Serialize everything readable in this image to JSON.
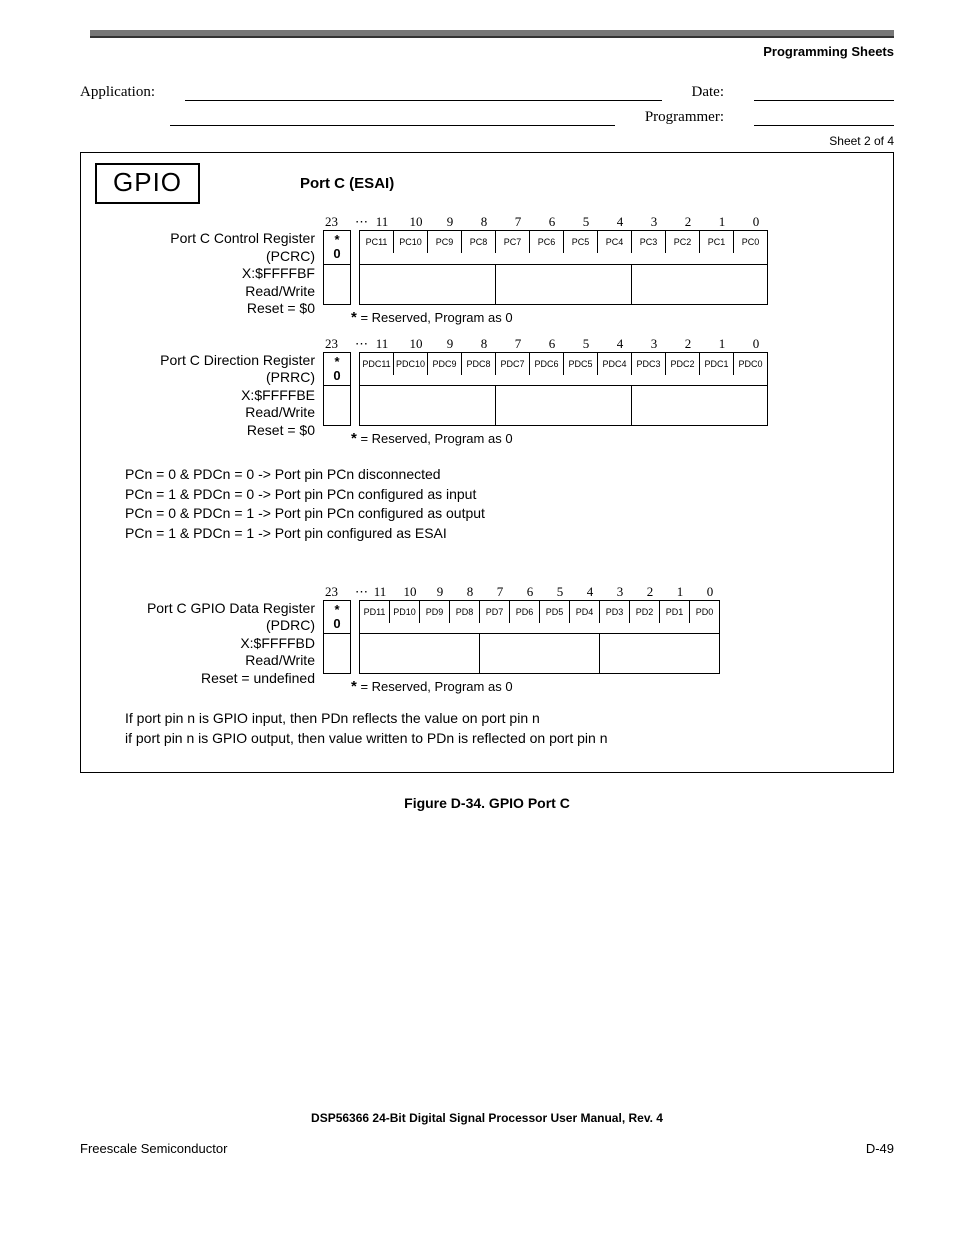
{
  "header": {
    "section": "Programming Sheets"
  },
  "form": {
    "application_label": "Application:",
    "date_label": "Date:",
    "programmer_label": "Programmer:",
    "sheet": "Sheet 2 of 4"
  },
  "diagram": {
    "gpio": "GPIO",
    "port_title": "Port C (ESAI)",
    "reserved_note_star": "*",
    "reserved_note": " = Reserved, Program as 0",
    "reg1": {
      "name": "Port C Control Register",
      "short": "(PCRC)",
      "addr": "X:$FFFFBF",
      "rw": "Read/Write",
      "reset": "Reset = $0",
      "bitnums": [
        "23",
        "⋯",
        "11",
        "10",
        "9",
        "8",
        "7",
        "6",
        "5",
        "4",
        "3",
        "2",
        "1",
        "0"
      ],
      "bits": [
        "PC11",
        "PC10",
        "PC9",
        "PC8",
        "PC7",
        "PC6",
        "PC5",
        "PC4",
        "PC3",
        "PC2",
        "PC1",
        "PC0"
      ],
      "star": "*",
      "zero": "0"
    },
    "reg2": {
      "name": "Port C Direction Register",
      "short": "(PRRC)",
      "addr": "X:$FFFFBE",
      "rw": "Read/Write",
      "reset": "Reset = $0",
      "bitnums": [
        "23",
        "⋯",
        "11",
        "10",
        "9",
        "8",
        "7",
        "6",
        "5",
        "4",
        "3",
        "2",
        "1",
        "0"
      ],
      "bits": [
        "PDC11",
        "PDC10",
        "PDC9",
        "PDC8",
        "PDC7",
        "PDC6",
        "PDC5",
        "PDC4",
        "PDC3",
        "PDC2",
        "PDC1",
        "PDC0"
      ],
      "star": "*",
      "zero": "0"
    },
    "reg3": {
      "name": "Port C GPIO Data Register",
      "short": "(PDRC)",
      "addr": "X:$FFFFBD",
      "rw": "Read/Write",
      "reset": "Reset = undefined",
      "bitnums": [
        "23",
        "⋯",
        "11",
        "10",
        "9",
        "8",
        "7",
        "6",
        "5",
        "4",
        "3",
        "2",
        "1",
        "0"
      ],
      "bits": [
        "PD11",
        "PD10",
        "PD9",
        "PD8",
        "PD7",
        "PD6",
        "PD5",
        "PD4",
        "PD3",
        "PD2",
        "PD1",
        "PD0"
      ],
      "star": "*",
      "zero": "0"
    },
    "notes1": [
      "PCn = 0 & PDCn = 0 -> Port pin PCn disconnected",
      "PCn = 1 & PDCn = 0 -> Port pin PCn configured as input",
      "PCn = 0 & PDCn = 1 -> Port pin PCn configured as output",
      "PCn = 1 & PDCn = 1 -> Port pin configured as ESAI"
    ],
    "notes2": [
      "If port pin n is GPIO input, then PDn reflects the value on port pin n",
      "if port pin n is GPIO output, then value written to PDn is reflected on port pin n"
    ]
  },
  "caption": "Figure D-34. GPIO Port C",
  "footer": {
    "manual": "DSP56366 24-Bit Digital Signal Processor User Manual, Rev. 4",
    "left": "Freescale Semiconductor",
    "right": "D-49"
  }
}
